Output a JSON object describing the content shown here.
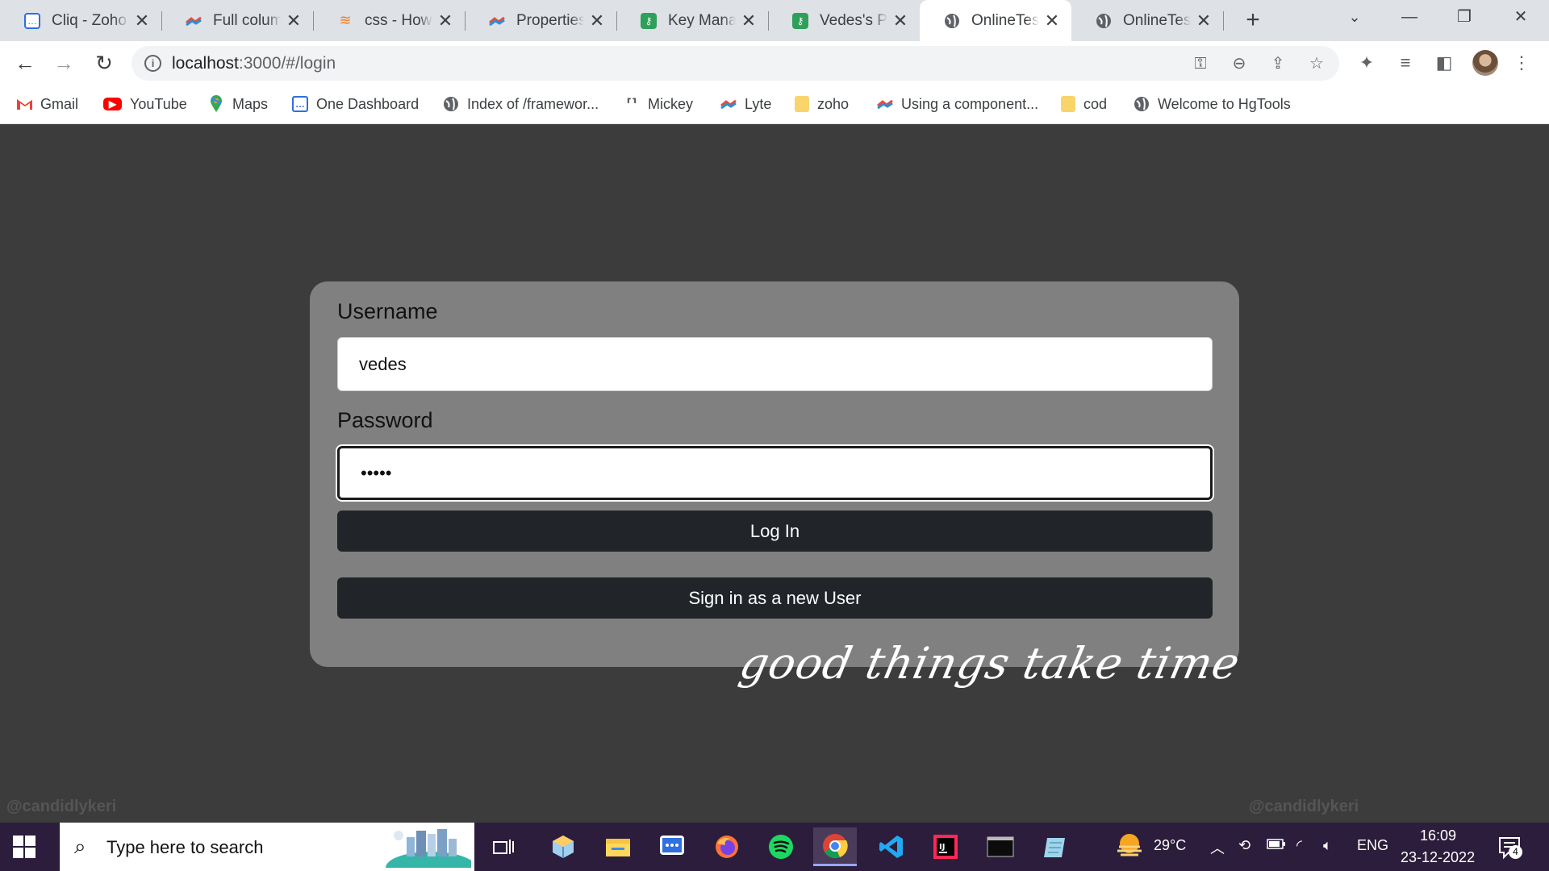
{
  "tabs": [
    {
      "title": "Cliq - Zoho",
      "favicon": "zoho-cliq-icon"
    },
    {
      "title": "Full column",
      "favicon": "zoho-creator-icon"
    },
    {
      "title": "css - How to",
      "favicon": "stackoverflow-icon"
    },
    {
      "title": "Properties",
      "favicon": "zoho-creator-icon"
    },
    {
      "title": "Key Manag",
      "favicon": "key-manager-icon"
    },
    {
      "title": "Vedes's Pro",
      "favicon": "key-manager-icon"
    },
    {
      "title": "OnlineTest",
      "favicon": "globe-icon",
      "active": true
    },
    {
      "title": "OnlineTest",
      "favicon": "globe-icon"
    }
  ],
  "address_bar": {
    "url_host": "localhost",
    "url_rest": ":3000/#/login"
  },
  "bookmarks": [
    {
      "label": "Gmail",
      "icon": "gmail-icon"
    },
    {
      "label": "YouTube",
      "icon": "youtube-icon"
    },
    {
      "label": "Maps",
      "icon": "maps-icon"
    },
    {
      "label": "One Dashboard",
      "icon": "zoho-cliq-icon"
    },
    {
      "label": "Index of /framewor...",
      "icon": "globe-icon"
    },
    {
      "label": "Mickey",
      "icon": "mickey-icon"
    },
    {
      "label": "Lyte",
      "icon": "zoho-creator-icon"
    },
    {
      "label": "zoho",
      "icon": "folder-icon"
    },
    {
      "label": "Using a component...",
      "icon": "zoho-creator-icon"
    },
    {
      "label": "cod",
      "icon": "folder-icon"
    },
    {
      "label": "Welcome to HgTools",
      "icon": "globe-icon"
    }
  ],
  "login": {
    "username_label": "Username",
    "username_value": "vedes",
    "password_label": "Password",
    "password_value": "vedes",
    "login_button": "Log In",
    "signup_button": "Sign in as a new User"
  },
  "quote": "good things take time",
  "watermark": "@candidlykeri",
  "taskbar": {
    "search_placeholder": "Type here to search",
    "weather": "29°C",
    "language": "ENG",
    "time": "16:09",
    "date": "23-12-2022",
    "notifications": "4"
  }
}
